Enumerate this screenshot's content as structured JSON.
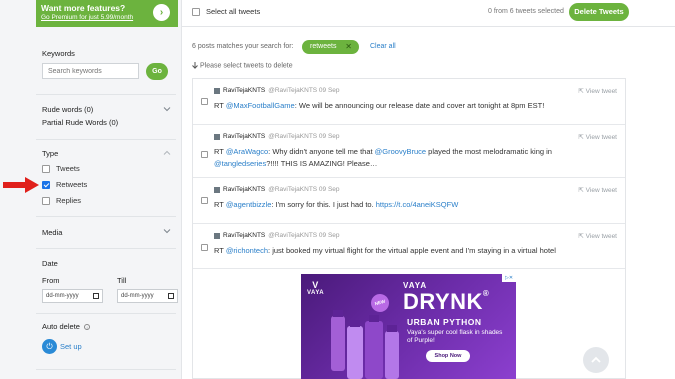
{
  "promo": {
    "title": "Want more features?",
    "link": "Go Premium for just 5.99/month",
    "arrow": "›"
  },
  "topbar": {
    "select_all": "Select all tweets",
    "selected_count": "0 from 6 tweets selected",
    "delete_button": "Delete Tweets"
  },
  "sidebar": {
    "keywords_label": "Keywords",
    "search_placeholder": "Search keywords",
    "go_button": "Go",
    "rude_words": "Rude words (0)",
    "partial_rude": "Partial Rude Words (0)",
    "type_label": "Type",
    "type_options": [
      {
        "label": "Tweets",
        "checked": false
      },
      {
        "label": "Retweets",
        "checked": true
      },
      {
        "label": "Replies",
        "checked": false
      }
    ],
    "media_label": "Media",
    "date_label": "Date",
    "from_label": "From",
    "till_label": "Till",
    "date_placeholder": "dd-mm-yyyy",
    "auto_delete_label": "Auto delete",
    "setup_label": "Set up"
  },
  "main": {
    "match_text": "6 posts matches your search for:",
    "chip_label": "retweets",
    "chip_close": "✕",
    "clear_all": "Clear all",
    "hint": "Please select tweets to delete",
    "view_label": "View tweet",
    "tweets": [
      {
        "name": "RaviTejaKNTS",
        "handle": "@RaviTejaKNTS 09 Sep",
        "prefix": "RT ",
        "mention": "@MaxFootballGame",
        "text": ": We will be announcing our release date and cover art tonight at 8pm EST!"
      },
      {
        "name": "RaviTejaKNTS",
        "handle": "@RaviTejaKNTS 09 Sep",
        "prefix": "RT ",
        "mention": "@AraWagco",
        "text_a": ": Why didn't anyone tell me that ",
        "mention_b": "@GroovyBruce",
        "text_b": " played the most melodramatic king in ",
        "mention_c": "@tangledseries",
        "text_c": "?!!!! THIS IS AMAZING! Please…"
      },
      {
        "name": "RaviTejaKNTS",
        "handle": "@RaviTejaKNTS 09 Sep",
        "prefix": "RT ",
        "mention": "@agentbizzle",
        "text": ": I'm sorry for this. I just had to. ",
        "link": "https://t.co/4aneiKSQFW"
      },
      {
        "name": "RaviTejaKNTS",
        "handle": "@RaviTejaKNTS 09 Sep",
        "prefix": "RT ",
        "mention": "@richontech",
        "text": ": just booked my virtual flight for the virtual apple event and I'm staying in a virtual hotel"
      }
    ]
  },
  "ad": {
    "brand_small": "VAYA",
    "badge": "NEW",
    "vaya": "VAYA",
    "drynk": "DRYNK",
    "reg": "®",
    "product": "URBAN PYTHON",
    "description": "Vaya's super cool flask in shades of Purple!",
    "shop_button": "Shop Now",
    "ad_marker": "▷✕"
  },
  "colors": {
    "accent_green": "#6cb33e",
    "link_blue": "#2a7fc9",
    "arrow_red": "#e0201b"
  }
}
